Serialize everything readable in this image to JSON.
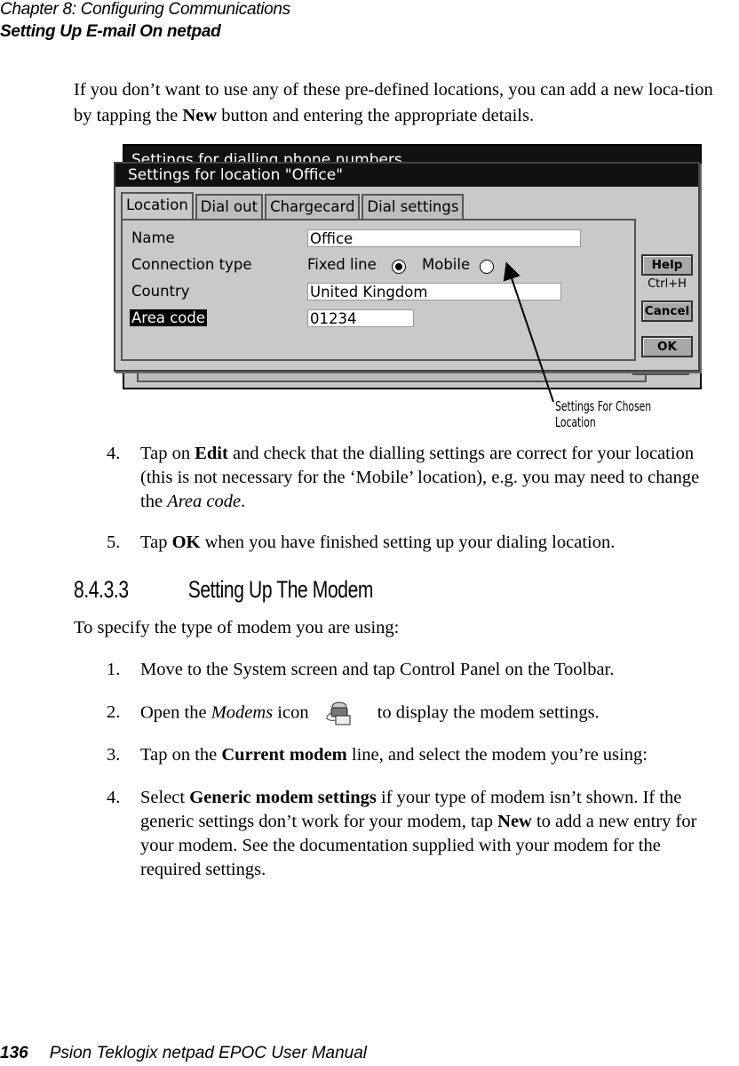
{
  "header": {
    "chapter": "Chapter 8:  Configuring Communications",
    "section": "Setting Up E-mail On netpad"
  },
  "intro": {
    "before": "If you don’t want to use any of these pre-defined locations, you can add a new loca-tion by tapping the ",
    "bold": "New",
    "after": " button and entering the appropriate details."
  },
  "screenshot": {
    "back_title": "Settings for dialling phone numbers",
    "title": "Settings for location \"Office\"",
    "tabs": [
      "Location",
      "Dial out",
      "Chargecard",
      "Dial settings"
    ],
    "active_tab": "Location",
    "fields": {
      "name_label": "Name",
      "name_value": "Office",
      "conn_label": "Connection type",
      "conn_opt1": "Fixed line",
      "conn_opt2": "Mobile",
      "conn_selected": "Fixed line",
      "country_label": "Country",
      "country_value": "United Kingdom",
      "area_label": "Area code",
      "area_value": "01234"
    },
    "buttons": {
      "help": "Help",
      "help_shortcut": "Ctrl+H",
      "cancel": "Cancel",
      "ok": "OK"
    },
    "callout": "Settings For Chosen Location"
  },
  "steps_a": [
    {
      "num": "4.",
      "pre": "Tap on ",
      "bold": "Edit",
      "post": " and check that the dialling settings are correct for your location (this is not necessary for the ‘Mobile’ location), e.g. you may need to change the ",
      "italic": "Area code",
      "end": "."
    },
    {
      "num": "5.",
      "pre": "Tap ",
      "bold": "OK",
      "post": " when you have finished setting up your dialing location."
    }
  ],
  "subsection": {
    "number": "8.4.3.3",
    "title": "Setting Up The Modem"
  },
  "modem_intro": "To specify the type of modem you are using:",
  "steps_b": [
    {
      "num": "1.",
      "text": "Move to the System screen and tap Control Panel on the Toolbar."
    },
    {
      "num": "2.",
      "pre": "Open the ",
      "italic": "Modems",
      "mid": " icon",
      "icon": "modems-icon",
      "post": " to display the modem settings."
    },
    {
      "num": "3.",
      "pre": "Tap on the ",
      "bold": "Current modem",
      "post": " line, and select the modem you’re using:"
    },
    {
      "num": "4.",
      "pre": "Select ",
      "bold": "Generic modem settings",
      "mid": " if your type of modem isn’t shown. If the generic settings don’t work for your modem, tap ",
      "bold2": "New",
      "post": " to add a new entry for your modem. See the documentation supplied with your modem for the required settings."
    }
  ],
  "footer": {
    "page": "136",
    "title": "Psion Teklogix netpad EPOC User Manual"
  }
}
